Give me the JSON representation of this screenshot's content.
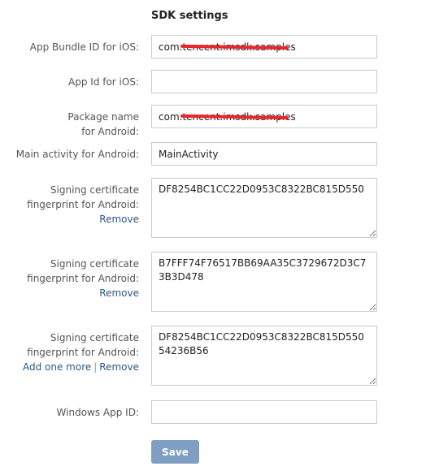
{
  "title": "SDK settings",
  "ios_bundle": {
    "label": "App Bundle ID for iOS:",
    "value": "com.tencent.imsdk.samples"
  },
  "ios_app_id": {
    "label": "App Id for iOS:",
    "value": ""
  },
  "android_package": {
    "label_line1": "Package name",
    "label_line2": "for Android:",
    "value": "com.tencent.imsdk.samples"
  },
  "android_activity": {
    "label": "Main activity for Android:",
    "value": "MainActivity"
  },
  "fingerprints": [
    {
      "label_line1": "Signing certificate",
      "label_line2": "fingerprint for Android:",
      "remove": "Remove",
      "value": "DF8254BC1CC22D0953C8322BC815D550"
    },
    {
      "label_line1": "Signing certificate",
      "label_line2": "fingerprint for Android:",
      "remove": "Remove",
      "value": "B7FFF74F76517BB69AA35C3729672D3C73B3D478"
    },
    {
      "label_line1": "Signing certificate",
      "label_line2": "fingerprint for Android:",
      "add_more": "Add one more",
      "separator": "|",
      "remove": "Remove",
      "value": "DF8254BC1CC22D0953C8322BC815D55054236B56"
    }
  ],
  "windows_app_id": {
    "label": "Windows App ID:",
    "value": ""
  },
  "save_label": "Save",
  "colors": {
    "link": "#2a5885",
    "button": "#7e9fc2",
    "redaction": "#e8262d",
    "border": "#c5cdd5"
  }
}
